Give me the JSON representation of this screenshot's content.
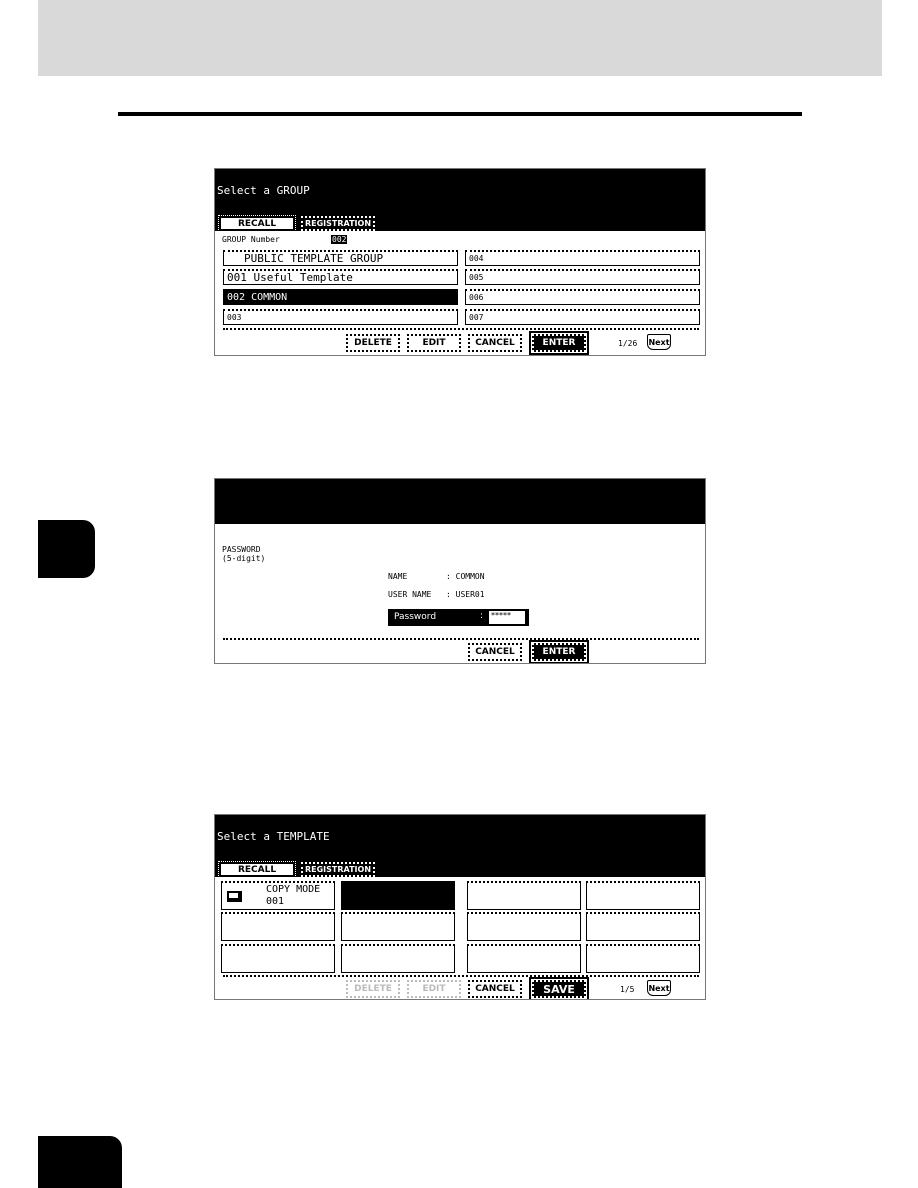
{
  "screen1": {
    "title": "Select a GROUP",
    "tabs": {
      "recall": "RECALL",
      "registration": "REGISTRATION"
    },
    "group_number_label": "GROUP Number",
    "group_number_value": "002",
    "left_items": [
      "PUBLIC TEMPLATE GROUP",
      "001 Useful Template",
      "002 COMMON",
      "003"
    ],
    "right_items": [
      "004",
      "005",
      "006",
      "007"
    ],
    "selected_item": "002 COMMON",
    "buttons": {
      "delete": "DELETE",
      "edit": "EDIT",
      "cancel": "CANCEL",
      "enter": "ENTER"
    },
    "page": "1/26",
    "next": "Next"
  },
  "screen2": {
    "password_label": "PASSWORD",
    "password_hint": "(5-digit)",
    "name_label": "NAME",
    "name_value": ": COMMON",
    "user_name_label": "USER NAME",
    "user_name_value": ": USER01",
    "password_field_label": "Password",
    "password_field_sep": ":",
    "password_value": "*****",
    "buttons": {
      "cancel": "CANCEL",
      "enter": "ENTER"
    }
  },
  "screen3": {
    "title": "Select a TEMPLATE",
    "tabs": {
      "recall": "RECALL",
      "registration": "REGISTRATION"
    },
    "first_template": {
      "line1": "COPY MODE",
      "line2": "001",
      "icon": "copy-mode-icon"
    },
    "buttons": {
      "delete": "DELETE",
      "edit": "EDIT",
      "cancel": "CANCEL",
      "save": "SAVE"
    },
    "disabled_buttons": [
      "DELETE",
      "EDIT"
    ],
    "page": "1/5",
    "next": "Next"
  }
}
